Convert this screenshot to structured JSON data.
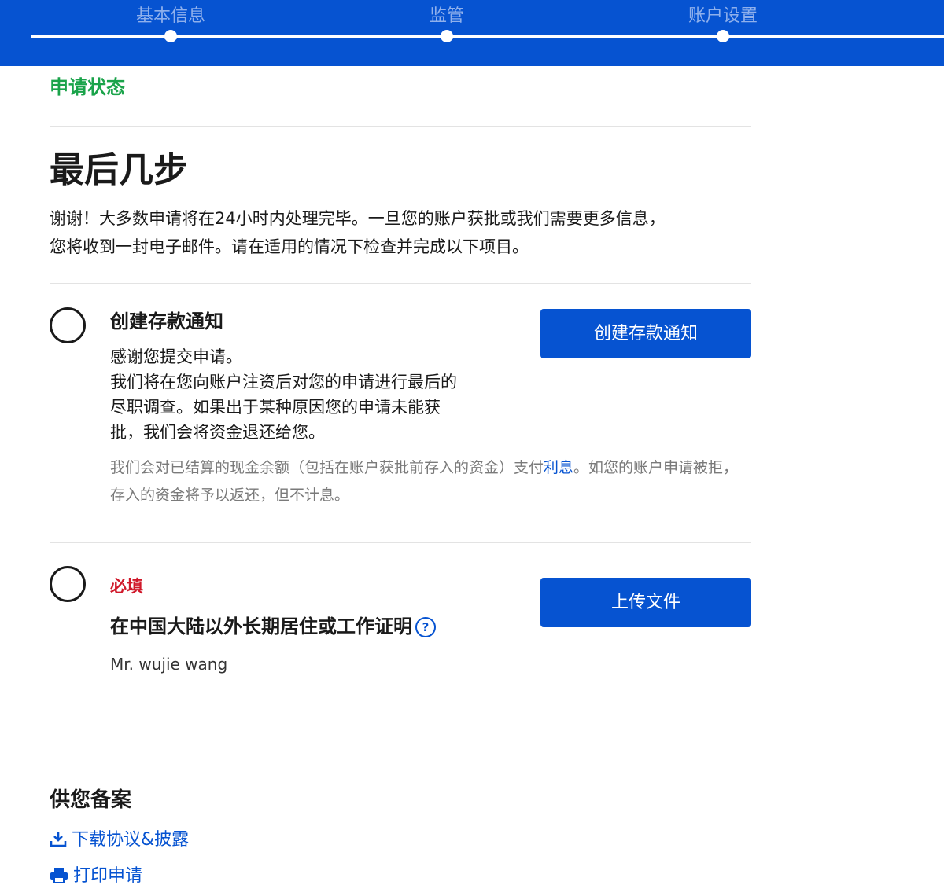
{
  "steps": [
    {
      "label": "基本信息"
    },
    {
      "label": "监管"
    },
    {
      "label": "账户设置"
    }
  ],
  "status_title": "申请状态",
  "page_title": "最后几步",
  "intro_line1": "谢谢！大多数申请将在24小时内处理完毕。一旦您的账户获批或我们需要更多信息，",
  "intro_line2": "您将收到一封电子邮件。请在适用的情况下检查并完成以下项目。",
  "task1": {
    "title": "创建存款通知",
    "desc_lines": [
      "感谢您提交申请。",
      "我们将在您向账户注资后对您的申请进行最后的",
      "尽职调查。如果出于某种原因您的申请未能获",
      "批，我们会将资金退还给您。"
    ],
    "note_before": "我们会对已结算的现金余额（包括在账户获批前存入的资金）支付",
    "note_link": "利息",
    "note_after": "。如您的账户申请被拒，存入的资金将予以返还，但不计息。",
    "button": "创建存款通知"
  },
  "task2": {
    "required": "必填",
    "title": "在中国大陆以外长期居住或工作证明",
    "help": "?",
    "applicant": "Mr. wujie wang",
    "button": "上传文件"
  },
  "records": {
    "title": "供您备案",
    "download": "下载协议&披露",
    "print": "打印申请"
  },
  "colors": {
    "brand": "#0653d1",
    "status_green": "#1aa34a",
    "required_red": "#d0182a"
  },
  "icons": {
    "download": "download-icon",
    "print": "printer-icon",
    "help": "help-circle-icon"
  }
}
